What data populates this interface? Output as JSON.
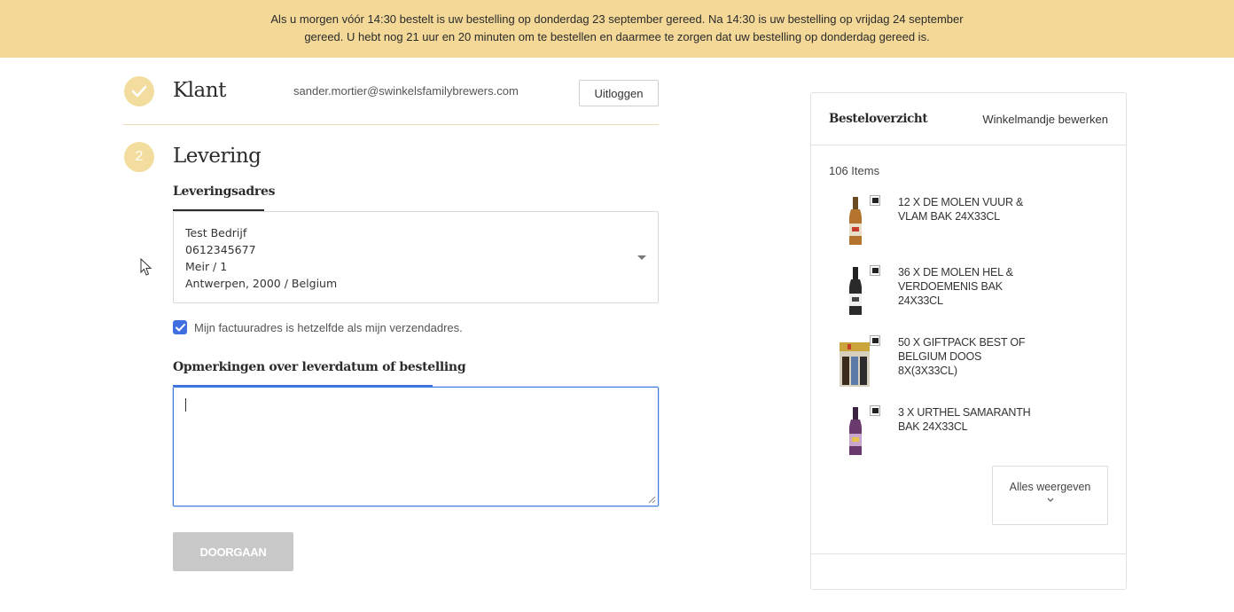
{
  "banner": {
    "line1": "Als u morgen vóór 14:30 bestelt is uw bestelling op donderdag 23 september gereed. Na 14:30 is uw bestelling op vrijdag 24 september",
    "line2": "gereed. U hebt nog 21 uur en 20 minuten om te bestellen en daarmee te zorgen dat uw bestelling op donderdag gereed is."
  },
  "customer": {
    "step_title": "Klant",
    "email": "sander.mortier@swinkelsfamilybrewers.com",
    "logout_label": "Uitloggen"
  },
  "delivery": {
    "step_number": "2",
    "step_title": "Levering",
    "address_heading": "Leveringsadres",
    "address_lines": [
      "Test Bedrijf",
      "0612345677",
      "Meir / 1",
      "Antwerpen, 2000 / Belgium"
    ],
    "billing_same_label": "Mijn factuuradres is hetzelfde als mijn verzendadres.",
    "billing_same_checked": true,
    "notes_heading": "Opmerkingen over leverdatum of bestelling",
    "notes_value": "",
    "continue_label": "DOORGAAN"
  },
  "summary": {
    "title": "Besteloverzicht",
    "edit_label": "Winkelmandje bewerken",
    "items_count": "106 Items",
    "items": [
      {
        "name": "12 X DE MOLEN VUUR & VLAM BAK 24X33CL",
        "icon": "beer-bottle-amber"
      },
      {
        "name": "36 X DE MOLEN HEL & VERDOEMENIS BAK 24X33CL",
        "icon": "beer-bottle-dark"
      },
      {
        "name": "50 X GIFTPACK BEST OF BELGIUM DOOS 8X(3X33CL)",
        "icon": "giftpack-box"
      },
      {
        "name": "3 X URTHEL SAMARANTH BAK 24X33CL",
        "icon": "beer-bottle-purple"
      }
    ],
    "show_all_label": "Alles weergeven"
  },
  "colors": {
    "banner_bg": "#f3d898",
    "step_circle": "#f2dc9e",
    "checkbox": "#3f6ee0",
    "focus_border": "#3f7de0",
    "disabled_button": "#c8c8c8"
  }
}
